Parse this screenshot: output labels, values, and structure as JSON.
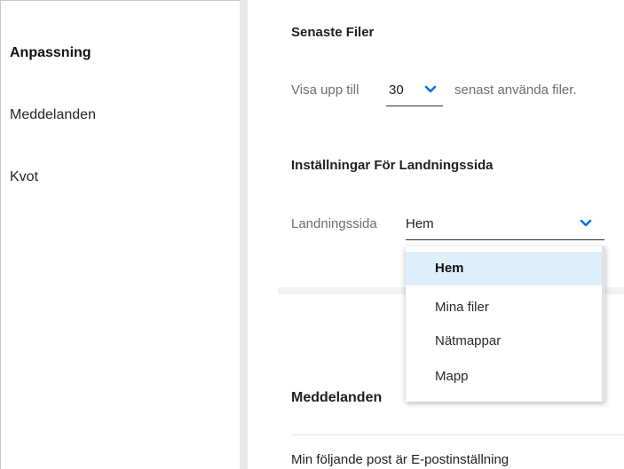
{
  "sidebar": {
    "items": [
      {
        "label": "Anpassning",
        "active": true
      },
      {
        "label": "Meddelanden",
        "active": false
      },
      {
        "label": "Kvot",
        "active": false
      }
    ]
  },
  "recent_files": {
    "heading": "Senaste Filer",
    "prefix": "Visa upp till",
    "selected_value": "30",
    "suffix": "senast använda filer."
  },
  "landing": {
    "heading": "Inställningar För Landningssida",
    "label": "Landningssida",
    "selected_value": "Hem",
    "options": [
      "Hem",
      "Mina filer",
      "Nätmappar",
      "Mapp"
    ],
    "highlighted_option": "Hem"
  },
  "notifications": {
    "heading": "Meddelanden",
    "first_line": "Min följande post är E-postinställning"
  },
  "colors": {
    "accent": "#0073e7",
    "highlight": "#dfeefb",
    "divider": "#e9e9e9"
  },
  "icons": {
    "dropdown": "chevron-down-icon"
  }
}
